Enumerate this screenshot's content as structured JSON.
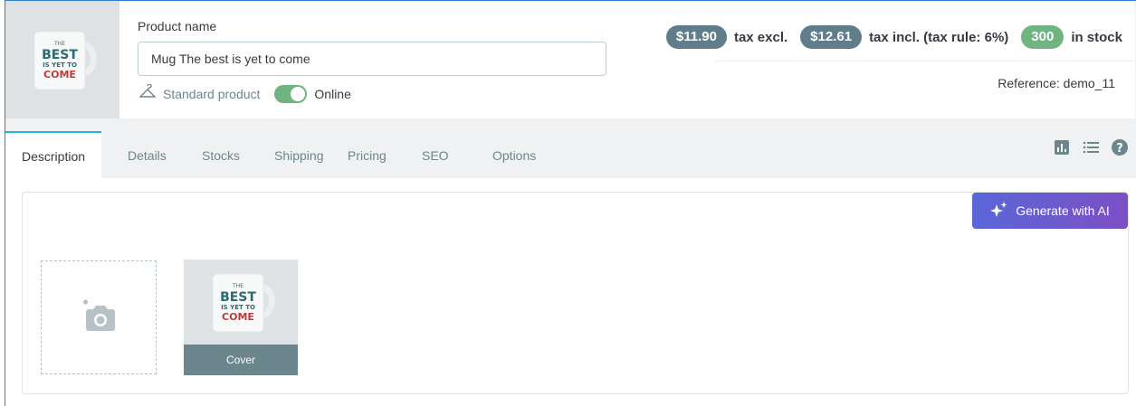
{
  "product": {
    "name_label": "Product name",
    "name_value": "Mug The best is yet to come",
    "type_label": "Standard product",
    "status_label": "Online",
    "status_on": true
  },
  "summary": {
    "price_excl": "$11.90",
    "price_excl_label": "tax excl.",
    "price_incl": "$12.61",
    "price_incl_label": "tax incl. (tax rule: 6%)",
    "stock": "300",
    "stock_label": "in stock",
    "reference": "Reference: demo_11"
  },
  "tabs": [
    {
      "label": "Description",
      "active": true
    },
    {
      "label": "Details"
    },
    {
      "label": "Stocks"
    },
    {
      "label": "Shipping"
    },
    {
      "label": "Pricing"
    },
    {
      "label": "SEO"
    },
    {
      "label": "Options"
    }
  ],
  "tools": [
    "chart-icon",
    "list-icon",
    "help-icon"
  ],
  "description": {
    "ai_button_label": "Generate with AI",
    "cover_label": "Cover"
  },
  "mug_text": {
    "line1": "THE",
    "line2": "BEST",
    "line3": "IS YET TO",
    "line4": "COME"
  },
  "colors": {
    "accent": "#25b9d7",
    "badge_gray": "#607d8b",
    "badge_green": "#70b580",
    "ai_gradient_start": "#5a67d8",
    "ai_gradient_end": "#7c4fc4"
  }
}
